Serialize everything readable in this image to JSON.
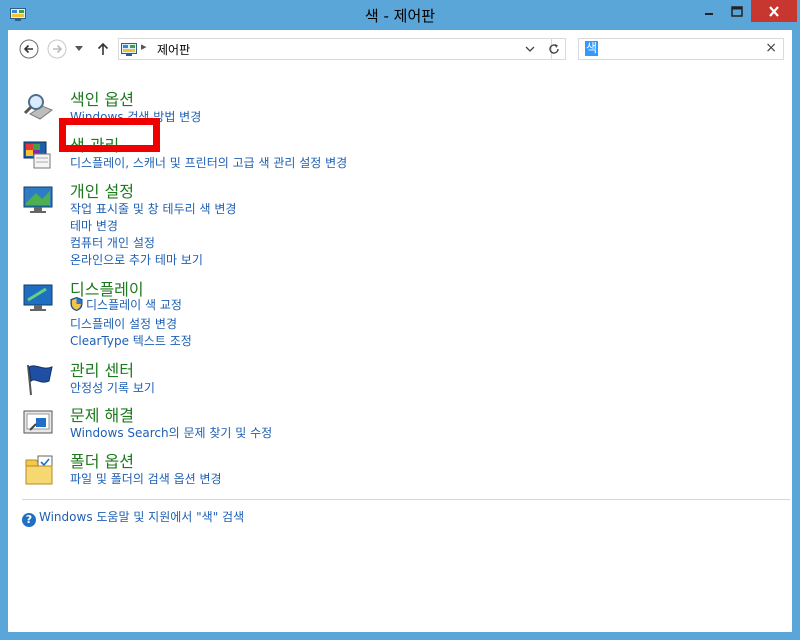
{
  "window": {
    "title": "색 - 제어판",
    "minimize_label": "minimize",
    "maximize_label": "maximize",
    "close_label": "close"
  },
  "nav": {
    "address_path": "제어판",
    "search_value": "색",
    "search_clear": "×"
  },
  "categories": [
    {
      "title": "색인 옵션",
      "icon": "magnifier-icon",
      "links": [
        "Windows 검색 방법 변경"
      ]
    },
    {
      "title": "색 관리",
      "icon": "color-management-icon",
      "links": [
        "디스플레이, 스캐너 및 프린터의 고급 색 관리 설정 변경"
      ]
    },
    {
      "title": "개인 설정",
      "icon": "personalization-icon",
      "links": [
        "작업 표시줄 및 창 테두리 색 변경",
        "테마 변경",
        "컴퓨터 개인 설정",
        "온라인으로 추가 테마 보기"
      ]
    },
    {
      "title": "디스플레이",
      "icon": "display-icon",
      "links": [
        "디스플레이 색 교정",
        "디스플레이 설정 변경",
        "ClearType 텍스트 조정"
      ]
    },
    {
      "title": "관리 센터",
      "icon": "action-center-flag-icon",
      "links": [
        "안정성 기록 보기"
      ]
    },
    {
      "title": "문제 해결",
      "icon": "troubleshooting-icon",
      "links": [
        "Windows Search의 문제 찾기 및 수정"
      ]
    },
    {
      "title": "폴더 옵션",
      "icon": "folder-options-icon",
      "links": [
        "파일 및 폴더의 검색 옵션 변경"
      ]
    }
  ],
  "help": {
    "icon": "help-icon",
    "glyph": "?",
    "text": "Windows 도움말 및 지원에서 \"색\" 검색"
  },
  "colors": {
    "title_bar": "#5aa6d8",
    "category_title": "#1e7a1e",
    "link": "#1e5fb4",
    "highlight_box": "#ee0000",
    "close_button": "#c7372f"
  }
}
